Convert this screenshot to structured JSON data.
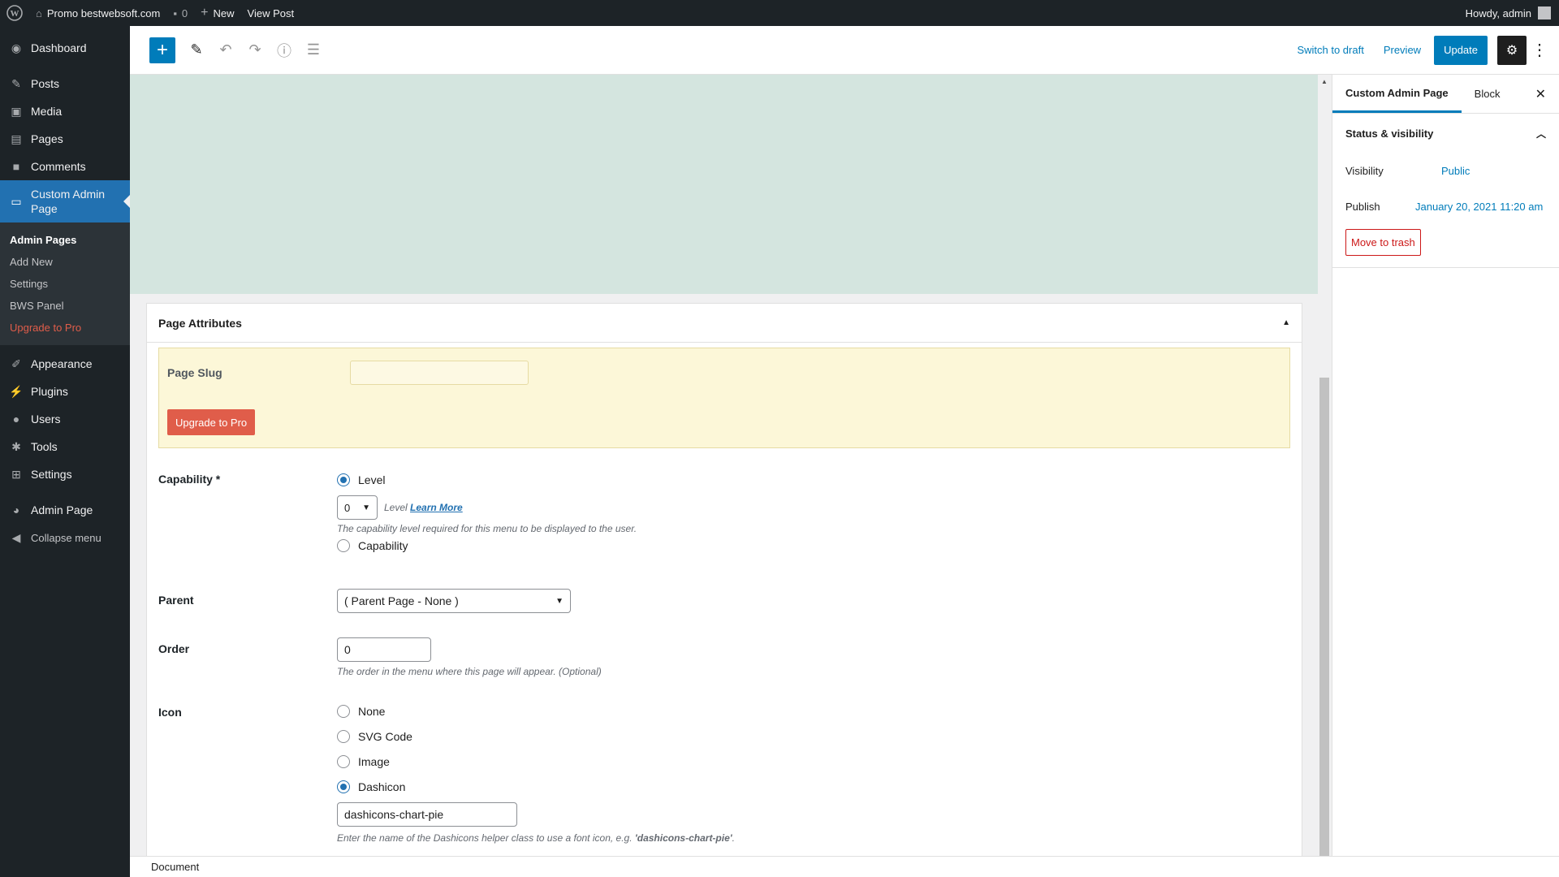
{
  "admin_bar": {
    "site_name": "Promo bestwebsoft.com",
    "comments_count": "0",
    "new_label": "New",
    "view_post_label": "View Post",
    "howdy": "Howdy, admin"
  },
  "sidebar": {
    "items": [
      {
        "label": "Dashboard",
        "icon": "dashboard-icon"
      },
      {
        "label": "Posts",
        "icon": "pin-icon"
      },
      {
        "label": "Media",
        "icon": "media-icon"
      },
      {
        "label": "Pages",
        "icon": "page-icon"
      },
      {
        "label": "Comments",
        "icon": "comment-icon"
      },
      {
        "label": "Custom Admin Page",
        "icon": "admin-page-icon"
      }
    ],
    "submenu": [
      {
        "label": "Admin Pages"
      },
      {
        "label": "Add New"
      },
      {
        "label": "Settings"
      },
      {
        "label": "BWS Panel"
      },
      {
        "label": "Upgrade to Pro"
      }
    ],
    "items2": [
      {
        "label": "Appearance",
        "icon": "brush-icon"
      },
      {
        "label": "Plugins",
        "icon": "plugin-icon"
      },
      {
        "label": "Users",
        "icon": "user-icon"
      },
      {
        "label": "Tools",
        "icon": "wrench-icon"
      },
      {
        "label": "Settings",
        "icon": "settings-grid-icon"
      }
    ],
    "admin_page": "Admin Page",
    "collapse": "Collapse menu"
  },
  "header": {
    "switch_to_draft": "Switch to draft",
    "preview": "Preview",
    "update": "Update"
  },
  "metabox": {
    "title": "Page Attributes",
    "page_slug_label": "Page Slug",
    "upgrade_button": "Upgrade to Pro",
    "capability_label": "Capability *",
    "level_option": "Level",
    "level_value": "0",
    "level_text": "Level",
    "learn_more": "Learn More",
    "capability_desc": "The capability level required for this menu to be displayed to the user.",
    "capability_option": "Capability",
    "parent_label": "Parent",
    "parent_value": "( Parent Page - None )",
    "order_label": "Order",
    "order_value": "0",
    "order_desc": "The order in the menu where this page will appear. (Optional)",
    "icon_label": "Icon",
    "icon_options": [
      "None",
      "SVG Code",
      "Image",
      "Dashicon"
    ],
    "dashicon_value": "dashicons-chart-pie",
    "icon_desc_prefix": "Enter the name of the Dashicons helper class to use a font icon, e.g. ",
    "icon_desc_example": "'dashicons-chart-pie'",
    "icon_desc_suffix": "."
  },
  "settings_panel": {
    "tab_document": "Custom Admin Page",
    "tab_block": "Block",
    "section_title": "Status & visibility",
    "visibility_label": "Visibility",
    "visibility_value": "Public",
    "publish_label": "Publish",
    "publish_value": "January 20, 2021 11:20 am",
    "trash_label": "Move to trash"
  },
  "footer": {
    "breadcrumb": "Document"
  },
  "colors": {
    "accent": "#007cba",
    "admin_dark": "#1d2327",
    "current_menu": "#2271b1",
    "pro_red": "#e05d4a",
    "canvas_bg": "#d4e5df"
  }
}
